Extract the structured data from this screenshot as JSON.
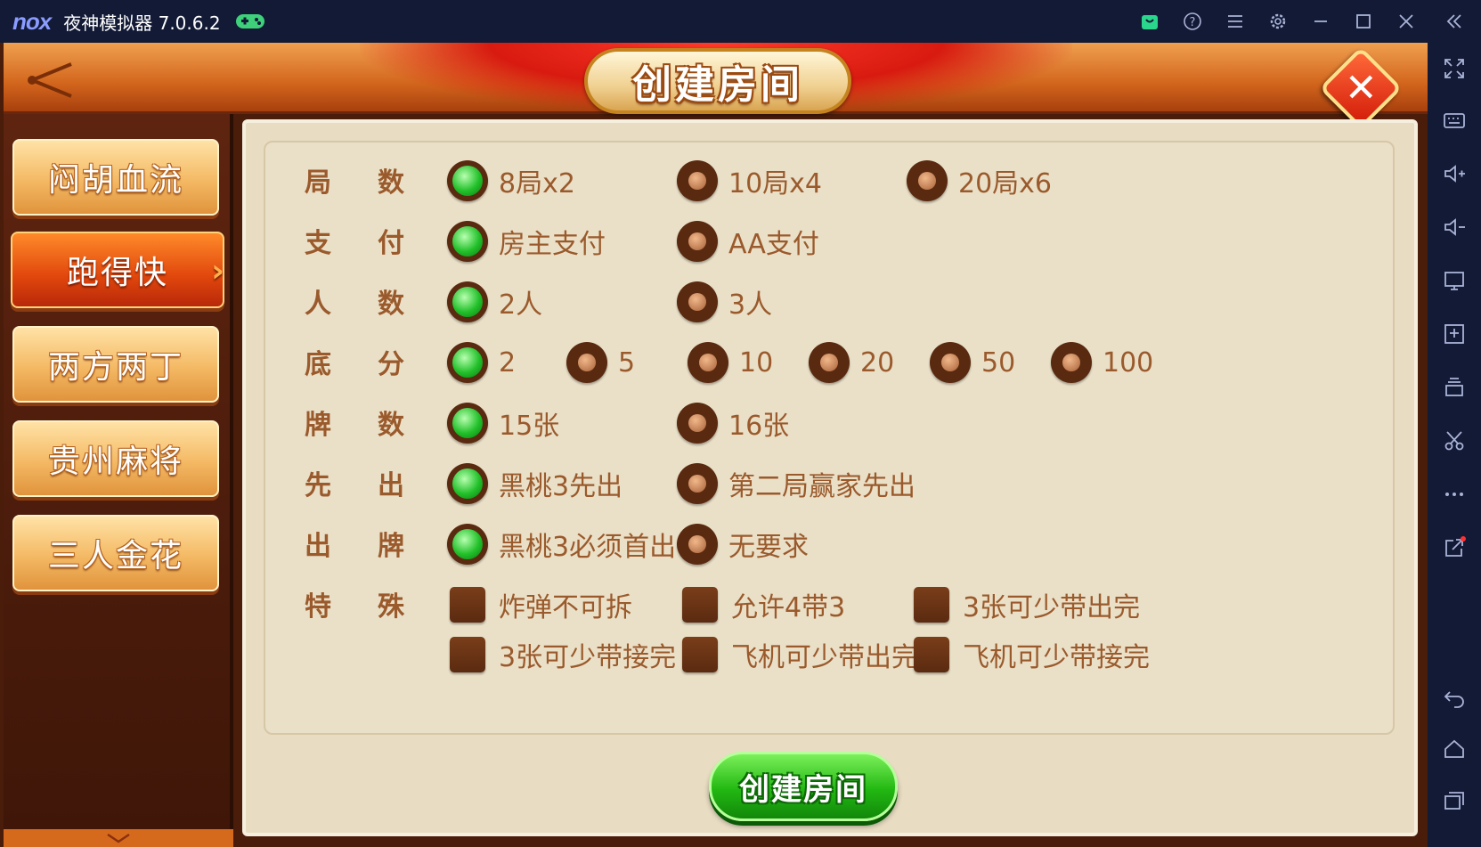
{
  "emulator": {
    "logo": "nox",
    "title": "夜神模拟器 7.0.6.2",
    "title_icons": [
      "gamepad-icon"
    ],
    "toolbar_icons": [
      "android-store-icon",
      "help-icon",
      "menu-icon",
      "settings-icon",
      "minimize-icon",
      "maximize-icon",
      "close-icon",
      "collapse-sidebar-icon"
    ],
    "sidebar_icons": [
      "fullscreen-icon",
      "keyboard-icon",
      "volume-up-icon",
      "volume-down-icon",
      "screen-icon",
      "add-apk-icon",
      "multi-instance-icon",
      "screenshot-scissors-icon",
      "more-icon",
      "share-icon",
      "back-icon",
      "home-icon",
      "recent-apps-icon"
    ]
  },
  "dialog": {
    "title": "创建房间",
    "close_symbol": "✕",
    "create_button": "创建房间"
  },
  "tabs": [
    {
      "label": "闷胡血流",
      "active": false
    },
    {
      "label": "跑得快",
      "active": true
    },
    {
      "label": "两方两丁",
      "active": false
    },
    {
      "label": "贵州麻将",
      "active": false
    },
    {
      "label": "三人金花",
      "active": false
    }
  ],
  "settings": {
    "rounds": {
      "label": "局数:",
      "options": [
        "8局x2",
        "10局x4",
        "20局x6"
      ],
      "selected": 0
    },
    "payment": {
      "label": "支付:",
      "options": [
        "房主支付",
        "AA支付"
      ],
      "selected": 0
    },
    "players": {
      "label": "人数:",
      "options": [
        "2人",
        "3人"
      ],
      "selected": 0
    },
    "base": {
      "label": "底分:",
      "options": [
        "2",
        "5",
        "10",
        "20",
        "50",
        "100"
      ],
      "selected": 0
    },
    "cards": {
      "label": "牌数:",
      "options": [
        "15张",
        "16张"
      ],
      "selected": 0
    },
    "first": {
      "label": "先出:",
      "options": [
        "黑桃3先出",
        "第二局赢家先出"
      ],
      "selected": 0
    },
    "play": {
      "label": "出牌:",
      "options": [
        "黑桃3必须首出",
        "无要求"
      ],
      "selected": 0
    },
    "special": {
      "label": "特殊:",
      "options": [
        "炸弹不可拆",
        "允许4带3",
        "3张可少带出完",
        "3张可少带接完",
        "飞机可少带出完",
        "飞机可少带接完"
      ],
      "checked": [
        false,
        false,
        false,
        false,
        false,
        false
      ]
    }
  },
  "colors": {
    "accent_green": "#22c02a",
    "label_brown": "#9a5a2c",
    "header_orange": "#d2651c",
    "panel_beige": "#e8dcc2"
  }
}
